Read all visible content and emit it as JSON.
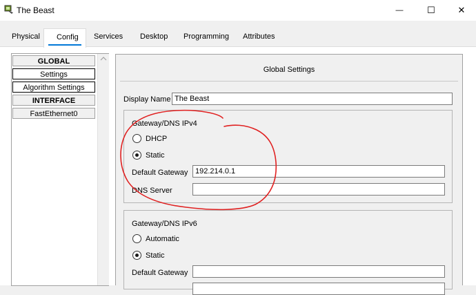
{
  "window": {
    "title": "The Beast",
    "minimize_glyph": "—",
    "maximize_glyph": "☐",
    "close_glyph": "✕"
  },
  "tabs": [
    {
      "label": "Physical"
    },
    {
      "label": "Config",
      "selected": true
    },
    {
      "label": "Services"
    },
    {
      "label": "Desktop"
    },
    {
      "label": "Programming"
    },
    {
      "label": "Attributes"
    }
  ],
  "nav": {
    "global_header": "GLOBAL",
    "settings": "Settings",
    "algorithm_settings": "Algorithm Settings",
    "interface_header": "INTERFACE",
    "fastethernet": "FastEthernet0"
  },
  "panel": {
    "title": "Global Settings",
    "display_name_label": "Display Name",
    "display_name_value": "The Beast",
    "ipv4": {
      "group_label": "Gateway/DNS IPv4",
      "dhcp_label": "DHCP",
      "static_label": "Static",
      "selected": "Static",
      "gateway_label": "Default Gateway",
      "gateway_value": "192.214.0.1",
      "dns_label": "DNS Server",
      "dns_value": ""
    },
    "ipv6": {
      "group_label": "Gateway/DNS IPv6",
      "automatic_label": "Automatic",
      "static_label": "Static",
      "selected": "Static",
      "gateway_label": "Default Gateway",
      "gateway_value": ""
    }
  },
  "colors": {
    "accent": "#0078d7",
    "annotation": "#e02020"
  },
  "icons": {
    "app": "packet-tracer-pc-icon"
  }
}
